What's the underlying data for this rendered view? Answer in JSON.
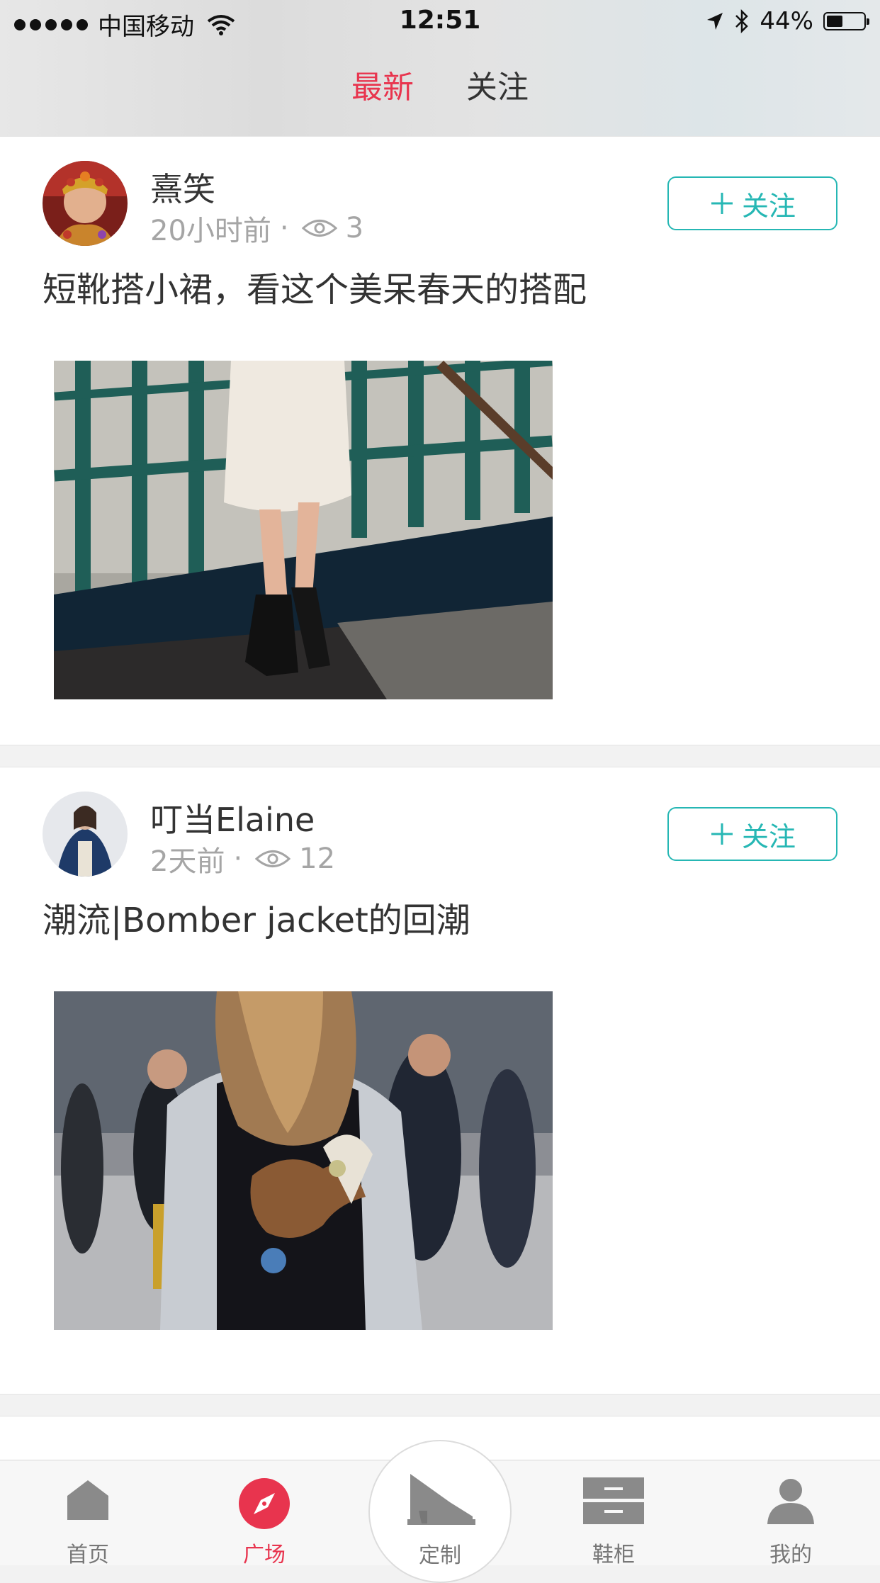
{
  "status_bar": {
    "carrier": "中国移动",
    "time": "12:51",
    "battery": "44%",
    "battery_level": 0.44
  },
  "tabs": [
    {
      "label": "最新",
      "active": true
    },
    {
      "label": "关注",
      "active": false
    }
  ],
  "posts": [
    {
      "username": "熹笑",
      "time": "20小时前",
      "separator": "·",
      "views": "3",
      "follow_label": "关注",
      "title": "短靴搭小裙，看这个美呆春天的搭配"
    },
    {
      "username": "叮当Elaine",
      "time": "2天前",
      "separator": "·",
      "views": "12",
      "follow_label": "关注",
      "title": "潮流|Bomber jacket的回潮"
    }
  ],
  "tabbar": {
    "items": [
      {
        "label": "首页",
        "icon": "home-icon",
        "active": false
      },
      {
        "label": "广场",
        "icon": "compass-icon",
        "active": true
      },
      {
        "label": "定制",
        "icon": "shoe-icon",
        "active": false
      },
      {
        "label": "鞋柜",
        "icon": "cabinet-icon",
        "active": false
      },
      {
        "label": "我的",
        "icon": "user-icon",
        "active": false
      }
    ]
  },
  "colors": {
    "accent": "#e8344e",
    "follow": "#26b7b4"
  }
}
